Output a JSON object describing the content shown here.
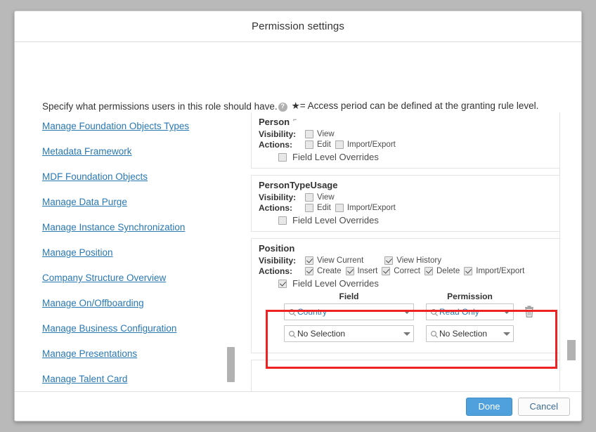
{
  "dialog": {
    "title": "Permission settings",
    "intro_text": "Specify what permissions users in this role should have.",
    "help_icon": "question-mark-circle-icon",
    "star_note": "★= Access period can be defined at the granting rule level."
  },
  "nav": {
    "items": [
      {
        "label": "Manage Foundation Objects Types"
      },
      {
        "label": "Metadata Framework"
      },
      {
        "label": "MDF Foundation Objects"
      },
      {
        "label": "Manage Data Purge"
      },
      {
        "label": "Manage Instance Synchronization"
      },
      {
        "label": "Manage Position"
      },
      {
        "label": "Company Structure Overview"
      },
      {
        "label": "Manage On/Offboarding"
      },
      {
        "label": "Manage Business Configuration"
      },
      {
        "label": "Manage Presentations"
      },
      {
        "label": "Manage Talent Card"
      }
    ]
  },
  "permissions": {
    "person": {
      "title": "Person",
      "title_sup": "⌐",
      "visibility_label": "Visibility:",
      "actions_label": "Actions:",
      "visibility": [
        {
          "label": "View",
          "checked": false
        }
      ],
      "actions": [
        {
          "label": "Edit",
          "checked": false
        },
        {
          "label": "Import/Export",
          "checked": false
        }
      ],
      "field_level_overrides": {
        "label": "Field Level Overrides",
        "checked": false
      }
    },
    "person_type_usage": {
      "title": "PersonTypeUsage",
      "visibility_label": "Visibility:",
      "actions_label": "Actions:",
      "visibility": [
        {
          "label": "View",
          "checked": false
        }
      ],
      "actions": [
        {
          "label": "Edit",
          "checked": false
        },
        {
          "label": "Import/Export",
          "checked": false
        }
      ],
      "field_level_overrides": {
        "label": "Field Level Overrides",
        "checked": false
      }
    },
    "position": {
      "title": "Position",
      "visibility_label": "Visibility:",
      "actions_label": "Actions:",
      "visibility": [
        {
          "label": "View Current",
          "checked": true
        },
        {
          "label": "View History",
          "checked": true
        }
      ],
      "actions": [
        {
          "label": "Create",
          "checked": true
        },
        {
          "label": "Insert",
          "checked": true
        },
        {
          "label": "Correct",
          "checked": true
        },
        {
          "label": "Delete",
          "checked": true
        },
        {
          "label": "Import/Export",
          "checked": true
        }
      ],
      "field_level_overrides": {
        "label": "Field Level Overrides",
        "checked": true
      },
      "field_table": {
        "header_field": "Field",
        "header_permission": "Permission",
        "rows": [
          {
            "field": "Country",
            "permission": "Read Only",
            "has_delete": true
          },
          {
            "field": "No Selection",
            "permission": "No Selection",
            "has_delete": false
          }
        ]
      },
      "highlight_color": "#ee2222"
    }
  },
  "footer": {
    "done_label": "Done",
    "cancel_label": "Cancel"
  }
}
